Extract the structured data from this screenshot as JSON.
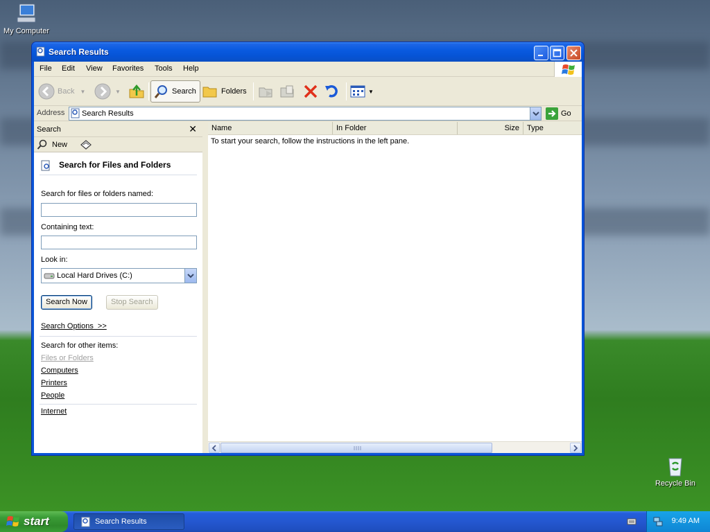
{
  "desktop": {
    "icons": [
      {
        "label": "My Computer"
      },
      {
        "label": "Recycle Bin"
      }
    ]
  },
  "window": {
    "title": "Search Results",
    "menu": [
      "File",
      "Edit",
      "View",
      "Favorites",
      "Tools",
      "Help"
    ],
    "toolbar": {
      "back": "Back",
      "search": "Search",
      "folders": "Folders"
    },
    "address": {
      "label": "Address",
      "value": "Search Results",
      "go": "Go"
    },
    "search_pane": {
      "header": "Search",
      "new_label": "New",
      "title": "Search for Files and Folders",
      "named_label": "Search for files or folders named:",
      "named_value": "",
      "containing_label": "Containing text:",
      "containing_value": "",
      "lookin_label": "Look in:",
      "lookin_value": "Local Hard Drives (C:)",
      "search_now": "Search Now",
      "stop_search": "Stop Search",
      "options_link": "Search Options  >>",
      "other_label": "Search for other items:",
      "other_items": [
        "Files or Folders",
        "Computers",
        "Printers",
        "People"
      ],
      "internet": "Internet"
    },
    "results": {
      "columns": [
        "Name",
        "In Folder",
        "Size",
        "Type"
      ],
      "message": "To start your search, follow the instructions in the left pane."
    }
  },
  "taskbar": {
    "start": "start",
    "task": "Search Results",
    "time": "9:49 AM"
  },
  "colors": {
    "titlebar": "#0a5ae0",
    "start": "#3b9c37",
    "taskbar": "#245edb"
  }
}
